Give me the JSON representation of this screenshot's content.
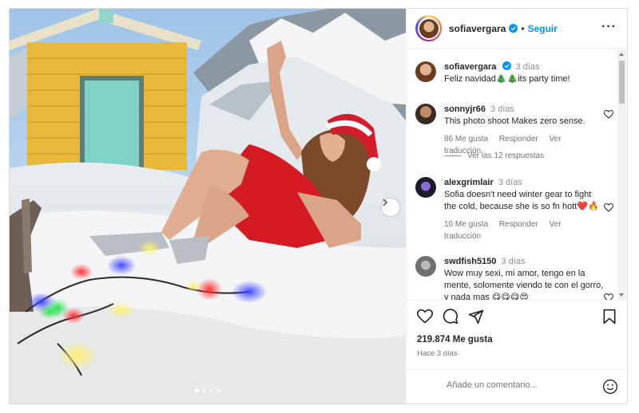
{
  "post": {
    "username": "sofiavergara",
    "follow_label": "Seguir",
    "separator": "•",
    "more_icon": "more-horizontal-icon"
  },
  "caption": {
    "username": "sofiavergara",
    "time": "3 días",
    "text": "Feliz navidad🎄🎄its party time!"
  },
  "comments": [
    {
      "username": "sonnyjr66",
      "time": "3 días",
      "text": "This photo shoot Makes zero sense.",
      "likes": "86 Me gusta",
      "reply_label": "Responder",
      "translate_label": "Ver traducción"
    },
    {
      "username": "alexgrimlair",
      "time": "3 días",
      "text": "Sofia doesn't need winter gear to fight the cold, because she is so fn hott❤️🔥",
      "likes": "10 Me gusta",
      "reply_label": "Responder",
      "translate_label": "Ver traducción"
    },
    {
      "username": "swdfish5150",
      "time": "3 días",
      "text": "Wow muy sexi, mi amor, tengo en la mente, solomente viendo te con el gorro, y nada mas 😋😋😋😍",
      "overflow_emojis": "😋😋😋❤️❤️❤️🔥🔥"
    }
  ],
  "view_replies": "Ver las 12 respuestas",
  "likes_total": "219.874 Me gusta",
  "posted_ago": "Hace 3 días",
  "comment_input": {
    "placeholder": "Añade un comentario..."
  },
  "carousel": {
    "active_index": 0,
    "count": 4
  },
  "colors": {
    "accent": "#0095f6",
    "text": "#262626",
    "muted": "#737373",
    "border": "#dbdbdb"
  }
}
